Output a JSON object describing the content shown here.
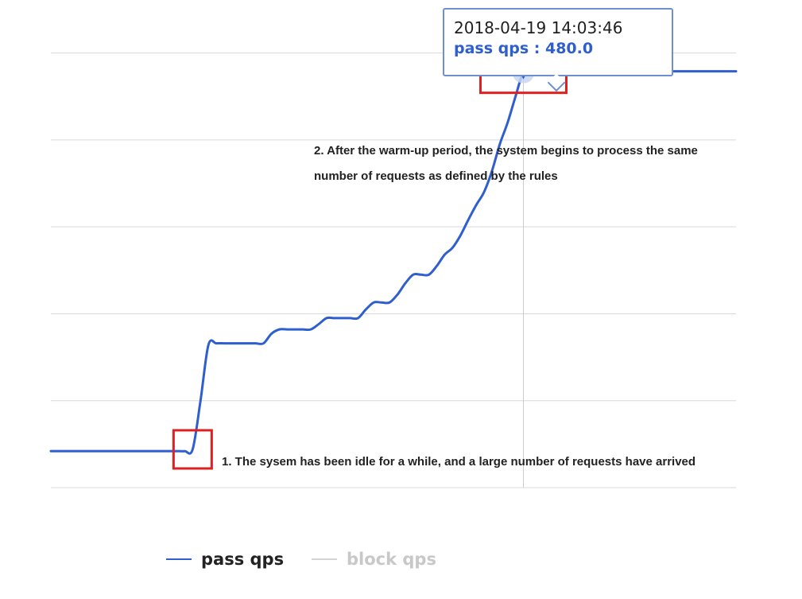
{
  "chart_data": {
    "type": "line",
    "title": "",
    "xlabel": "",
    "ylabel": "",
    "grid": true,
    "legend_placement": "bottom",
    "colors": {
      "pass": "#2f5fcf",
      "block": "#d4d4d4",
      "highlight": "#e02020"
    },
    "series": [
      {
        "name": "pass qps",
        "x": [
          0,
          1,
          2,
          3,
          4,
          5,
          6,
          7,
          8,
          9,
          10,
          11,
          12,
          13,
          14,
          15,
          16,
          17,
          18,
          19,
          20,
          21,
          22,
          23,
          24,
          25,
          26,
          27,
          28,
          29,
          30,
          31,
          32,
          33,
          34,
          35,
          36,
          37,
          38,
          39,
          40,
          41,
          42,
          43,
          44,
          45,
          46,
          47,
          48,
          49,
          50,
          51,
          52,
          53,
          54,
          55,
          56,
          57,
          58,
          59,
          60,
          61,
          62,
          63,
          64,
          65,
          66,
          67,
          68,
          69,
          70,
          71,
          72,
          73,
          74,
          75,
          76,
          77,
          78,
          79,
          80,
          81,
          82,
          83,
          84,
          85,
          86,
          87
        ],
        "values": [
          42,
          42,
          42,
          42,
          42,
          42,
          42,
          42,
          42,
          42,
          42,
          42,
          42,
          42,
          42,
          42,
          42,
          42,
          44,
          100,
          164,
          166,
          166,
          166,
          166,
          166,
          166,
          166,
          177,
          182,
          182,
          182,
          182,
          182,
          188,
          195,
          195,
          195,
          195,
          195,
          205,
          213,
          213,
          213,
          222,
          235,
          245,
          245,
          245,
          255,
          268,
          276,
          290,
          308,
          325,
          340,
          364,
          395,
          420,
          450,
          478,
          480,
          480,
          479,
          479,
          479,
          479,
          479,
          478,
          479,
          479,
          479,
          479,
          479,
          479,
          478,
          479,
          479,
          479,
          479,
          479,
          479,
          479,
          479,
          479,
          479,
          479,
          479
        ]
      },
      {
        "name": "block qps",
        "x": [],
        "values": []
      }
    ],
    "ylim": [
      0,
      550
    ],
    "tooltip": {
      "time": "2018-04-19 14:03:46",
      "label": "pass qps : 480.0",
      "index": 60
    },
    "annotations": [
      {
        "id": 1,
        "text": "1. The sysem has been idle for a while, and a large number of requests have arrived",
        "index": 18
      },
      {
        "id": 2,
        "text": "2. After the warm-up period, the system begins to process the same number of requests as defined by the rules",
        "index": 60
      }
    ]
  }
}
